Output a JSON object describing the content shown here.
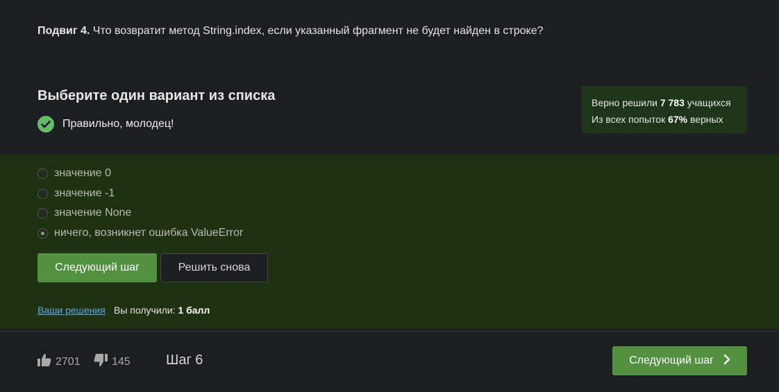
{
  "question": {
    "prefix": "Подвиг 4.",
    "text": " Что возвратит метод String.index, если указанный фрагмент не будет найден в строке?"
  },
  "choose_title": "Выберите один вариант из списка",
  "result_message": "Правильно, молодец!",
  "stats": {
    "solved_prefix": "Верно решили ",
    "solved_count": "7 783",
    "solved_suffix": " учащихся",
    "attempts_prefix": "Из всех попыток ",
    "attempts_percent": "67%",
    "attempts_suffix": " верных"
  },
  "options": [
    {
      "label": "значение 0",
      "checked": false
    },
    {
      "label": "значение -1",
      "checked": false
    },
    {
      "label": "значение None",
      "checked": false
    },
    {
      "label": "ничего, возникнет ошибка ValueError",
      "checked": true
    }
  ],
  "buttons": {
    "next_step": "Следующий шаг",
    "retry": "Решить снова"
  },
  "solutions_link": "Ваши решения",
  "score": {
    "prefix": "Вы получили: ",
    "value": "1 балл"
  },
  "footer": {
    "likes": "2701",
    "dislikes": "145",
    "step": "Шаг 6",
    "next_step": "Следующий шаг"
  },
  "colors": {
    "accent_green": "#519140",
    "panel_green": "#1e3212",
    "success_icon": "#66bb6a",
    "link": "#64a8e6"
  },
  "icons": {
    "success": "check-circle-icon",
    "like": "thumbs-up-icon",
    "dislike": "thumbs-down-icon",
    "next": "chevron-right-icon"
  }
}
